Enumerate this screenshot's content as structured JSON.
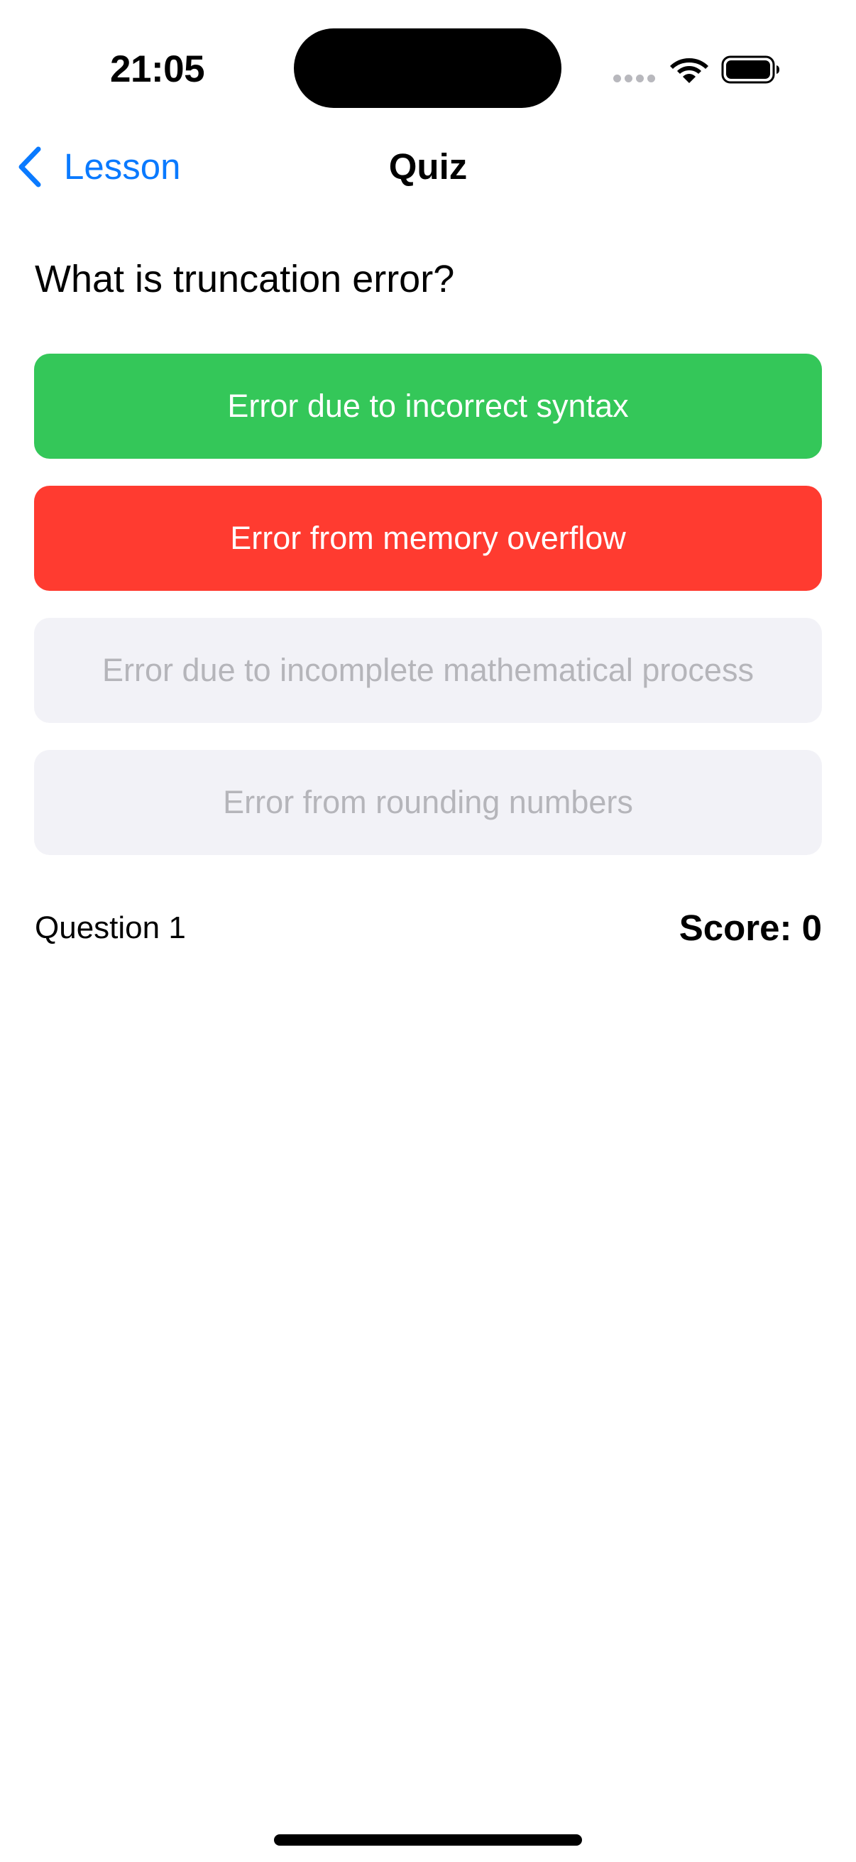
{
  "status_bar": {
    "time": "21:05"
  },
  "nav": {
    "back_label": "Lesson",
    "title": "Quiz"
  },
  "question": {
    "text": "What is truncation error?"
  },
  "answers": [
    {
      "label": "Error due to incorrect syntax",
      "state": "correct"
    },
    {
      "label": "Error from memory overflow",
      "state": "wrong"
    },
    {
      "label": "Error due to incomplete mathematical process",
      "state": "disabled"
    },
    {
      "label": "Error from rounding numbers",
      "state": "disabled"
    }
  ],
  "footer": {
    "question_number": "Question 1",
    "score": "Score: 0"
  },
  "colors": {
    "accent": "#0A7AFF",
    "correct": "#34C759",
    "wrong": "#FF3B30",
    "disabled_bg": "#F2F2F7",
    "disabled_text": "#B5B5BA"
  },
  "icons": {
    "back": "chevron-left-icon",
    "wifi": "wifi-icon",
    "battery": "battery-icon",
    "signal": "cellular-signal-icon"
  }
}
